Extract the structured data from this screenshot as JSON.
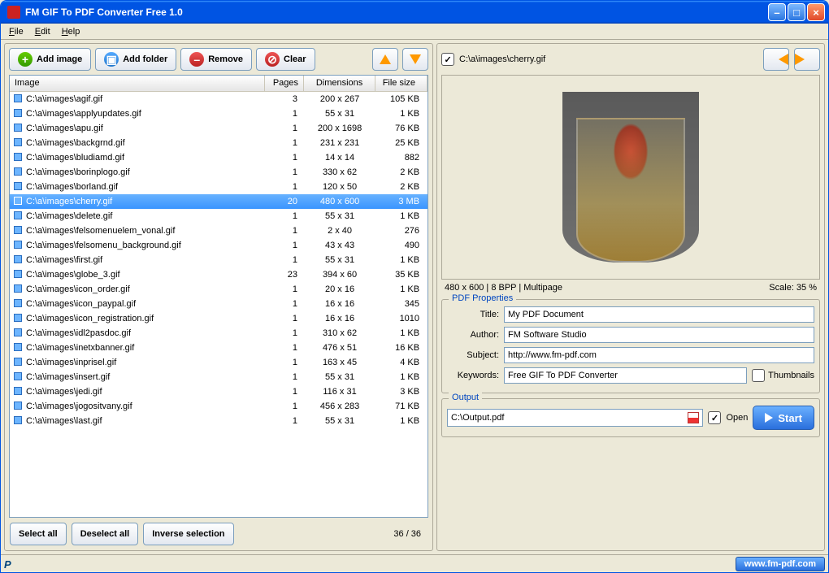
{
  "window": {
    "title": "FM GIF To PDF Converter Free 1.0"
  },
  "menu": {
    "file": "File",
    "edit": "Edit",
    "help": "Help"
  },
  "toolbar": {
    "add_image": "Add image",
    "add_folder": "Add folder",
    "remove": "Remove",
    "clear": "Clear"
  },
  "table": {
    "headers": {
      "image": "Image",
      "pages": "Pages",
      "dimensions": "Dimensions",
      "filesize": "File size"
    },
    "rows": [
      {
        "path": "C:\\a\\images\\agif.gif",
        "pages": "3",
        "dim": "200 x 267",
        "size": "105 KB",
        "sel": false
      },
      {
        "path": "C:\\a\\images\\applyupdates.gif",
        "pages": "1",
        "dim": "55 x 31",
        "size": "1 KB",
        "sel": false
      },
      {
        "path": "C:\\a\\images\\apu.gif",
        "pages": "1",
        "dim": "200 x 1698",
        "size": "76 KB",
        "sel": false
      },
      {
        "path": "C:\\a\\images\\backgrnd.gif",
        "pages": "1",
        "dim": "231 x 231",
        "size": "25 KB",
        "sel": false
      },
      {
        "path": "C:\\a\\images\\bludiamd.gif",
        "pages": "1",
        "dim": "14 x 14",
        "size": "882",
        "sel": false
      },
      {
        "path": "C:\\a\\images\\borinplogo.gif",
        "pages": "1",
        "dim": "330 x 62",
        "size": "2 KB",
        "sel": false
      },
      {
        "path": "C:\\a\\images\\borland.gif",
        "pages": "1",
        "dim": "120 x 50",
        "size": "2 KB",
        "sel": false
      },
      {
        "path": "C:\\a\\images\\cherry.gif",
        "pages": "20",
        "dim": "480 x 600",
        "size": "3 MB",
        "sel": true
      },
      {
        "path": "C:\\a\\images\\delete.gif",
        "pages": "1",
        "dim": "55 x 31",
        "size": "1 KB",
        "sel": false
      },
      {
        "path": "C:\\a\\images\\felsomenuelem_vonal.gif",
        "pages": "1",
        "dim": "2 x 40",
        "size": "276",
        "sel": false
      },
      {
        "path": "C:\\a\\images\\felsomenu_background.gif",
        "pages": "1",
        "dim": "43 x 43",
        "size": "490",
        "sel": false
      },
      {
        "path": "C:\\a\\images\\first.gif",
        "pages": "1",
        "dim": "55 x 31",
        "size": "1 KB",
        "sel": false
      },
      {
        "path": "C:\\a\\images\\globe_3.gif",
        "pages": "23",
        "dim": "394 x 60",
        "size": "35 KB",
        "sel": false
      },
      {
        "path": "C:\\a\\images\\icon_order.gif",
        "pages": "1",
        "dim": "20 x 16",
        "size": "1 KB",
        "sel": false
      },
      {
        "path": "C:\\a\\images\\icon_paypal.gif",
        "pages": "1",
        "dim": "16 x 16",
        "size": "345",
        "sel": false
      },
      {
        "path": "C:\\a\\images\\icon_registration.gif",
        "pages": "1",
        "dim": "16 x 16",
        "size": "1010",
        "sel": false
      },
      {
        "path": "C:\\a\\images\\idl2pasdoc.gif",
        "pages": "1",
        "dim": "310 x 62",
        "size": "1 KB",
        "sel": false
      },
      {
        "path": "C:\\a\\images\\inetxbanner.gif",
        "pages": "1",
        "dim": "476 x 51",
        "size": "16 KB",
        "sel": false
      },
      {
        "path": "C:\\a\\images\\inprisel.gif",
        "pages": "1",
        "dim": "163 x 45",
        "size": "4 KB",
        "sel": false
      },
      {
        "path": "C:\\a\\images\\insert.gif",
        "pages": "1",
        "dim": "55 x 31",
        "size": "1 KB",
        "sel": false
      },
      {
        "path": "C:\\a\\images\\jedi.gif",
        "pages": "1",
        "dim": "116 x 31",
        "size": "3 KB",
        "sel": false
      },
      {
        "path": "C:\\a\\images\\jogositvany.gif",
        "pages": "1",
        "dim": "456 x 283",
        "size": "71 KB",
        "sel": false
      },
      {
        "path": "C:\\a\\images\\last.gif",
        "pages": "1",
        "dim": "55 x 31",
        "size": "1 KB",
        "sel": false
      }
    ]
  },
  "bottom": {
    "select_all": "Select all",
    "deselect_all": "Deselect all",
    "inverse": "Inverse selection",
    "counter": "36 / 36"
  },
  "preview": {
    "path": "C:\\a\\images\\cherry.gif",
    "info_left": "480 x 600  |  8 BPP  |  Multipage",
    "info_right": "Scale: 35 %"
  },
  "pdf": {
    "legend": "PDF Properties",
    "title_label": "Title:",
    "title_value": "My PDF Document",
    "author_label": "Author:",
    "author_value": "FM Software Studio",
    "subject_label": "Subject:",
    "subject_value": "http://www.fm-pdf.com",
    "keywords_label": "Keywords:",
    "keywords_value": "Free GIF To PDF Converter",
    "thumbnails": "Thumbnails"
  },
  "output": {
    "legend": "Output",
    "path": "C:\\Output.pdf",
    "open": "Open",
    "start": "Start"
  },
  "statusbar": {
    "link": "www.fm-pdf.com"
  }
}
